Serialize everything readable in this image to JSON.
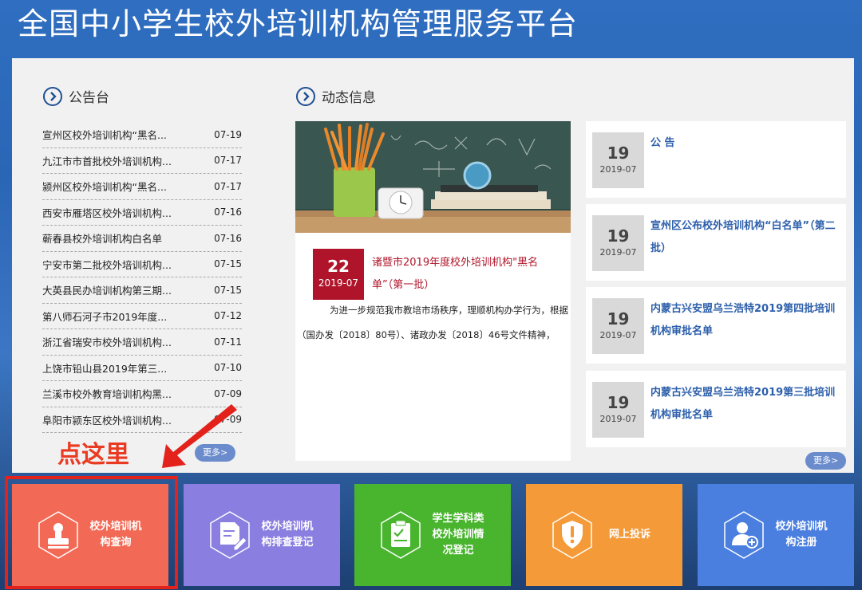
{
  "site_title": "全国中小学生校外培训机构管理服务平台",
  "notice_board": {
    "title": "公告台",
    "more": "更多>",
    "items": [
      {
        "title": "宣州区校外培训机构“黑名...",
        "date": "07-19"
      },
      {
        "title": "九江市市首批校外培训机构...",
        "date": "07-17"
      },
      {
        "title": "颍州区校外培训机构“黑名...",
        "date": "07-17"
      },
      {
        "title": "西安市雁塔区校外培训机构...",
        "date": "07-16"
      },
      {
        "title": "蕲春县校外培训机构白名单",
        "date": "07-16"
      },
      {
        "title": "宁安市第二批校外培训机构...",
        "date": "07-15"
      },
      {
        "title": "大英县民办培训机构第三期...",
        "date": "07-15"
      },
      {
        "title": "第八师石河子市2019年度...",
        "date": "07-12"
      },
      {
        "title": "浙江省瑞安市校外培训机构...",
        "date": "07-11"
      },
      {
        "title": "上饶市铅山县2019年第三...",
        "date": "07-10"
      },
      {
        "title": "兰溪市校外教育培训机构黑...",
        "date": "07-09"
      },
      {
        "title": "阜阳市颍东区校外培训机构...",
        "date": "07-09"
      }
    ]
  },
  "news": {
    "title": "动态信息",
    "more": "更多>",
    "featured": {
      "day": "22",
      "month": "2019-07",
      "title": "诸暨市2019年度校外培训机构\"黑名单”（第一批）",
      "excerpt_line1": "为进一步规范我市教培市场秩序，理顺机构办学行为，根据",
      "excerpt_line2": "（国办发〔2018〕80号）、诸政办发〔2018〕46号文件精神，"
    },
    "cards": [
      {
        "day": "19",
        "month": "2019-07",
        "title": "公 告"
      },
      {
        "day": "19",
        "month": "2019-07",
        "title": "宣州区公布校外培训机构“白名单”（第二批）"
      },
      {
        "day": "19",
        "month": "2019-07",
        "title": "内蒙古兴安盟乌兰浩特2019第四批培训机构审批名单"
      },
      {
        "day": "19",
        "month": "2019-07",
        "title": "内蒙古兴安盟乌兰浩特2019第三批培训机构审批名单"
      }
    ]
  },
  "annotation": {
    "text": "点这里"
  },
  "tiles": [
    {
      "label": "校外培训机构查询",
      "color": "#f26a55",
      "icon": "stamp-icon"
    },
    {
      "label": "校外培训机构排查登记",
      "color": "#8a7fe0",
      "icon": "edit-doc-icon"
    },
    {
      "label": "学生学科类校外培训情况登记",
      "color": "#49b52f",
      "icon": "clipboard-icon"
    },
    {
      "label": "网上投诉",
      "color": "#f59a38",
      "icon": "shield-alert-icon"
    },
    {
      "label": "校外培训机构注册",
      "color": "#4a7fe0",
      "icon": "add-user-icon"
    }
  ]
}
